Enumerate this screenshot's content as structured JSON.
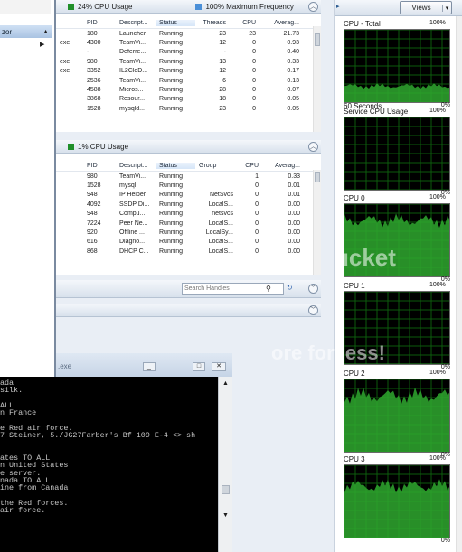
{
  "left_panel": {
    "menu_label": "zor"
  },
  "cpu_section": {
    "title": "24% CPU Usage",
    "freq": "100% Maximum Frequency",
    "color_cpu": "#1f8f2a",
    "color_freq": "#4a8fd8",
    "headers": [
      "PID",
      "Descript...",
      "Status",
      "Threads",
      "CPU",
      "Averag..."
    ],
    "partial_names": [
      "",
      "exe",
      "",
      "exe",
      "exe",
      "",
      "",
      "",
      ""
    ],
    "rows": [
      [
        "180",
        "Launcher",
        "Running",
        "23",
        "23",
        "21.73"
      ],
      [
        "4300",
        "TeamVi...",
        "Running",
        "12",
        "0",
        "0.93"
      ],
      [
        "-",
        "Deferre...",
        "Running",
        "-",
        "0",
        "0.40"
      ],
      [
        "980",
        "TeamVi...",
        "Running",
        "13",
        "0",
        "0.33"
      ],
      [
        "3352",
        "IL2CloD...",
        "Running",
        "12",
        "0",
        "0.17"
      ],
      [
        "2536",
        "TeamVi...",
        "Running",
        "6",
        "0",
        "0.13"
      ],
      [
        "4588",
        "Micros...",
        "Running",
        "28",
        "0",
        "0.07"
      ],
      [
        "3868",
        "Resour...",
        "Running",
        "18",
        "0",
        "0.05"
      ],
      [
        "1528",
        "mysqld...",
        "Running",
        "23",
        "0",
        "0.05"
      ]
    ]
  },
  "service_section": {
    "title": "1% CPU Usage",
    "color": "#1f8f2a",
    "headers": [
      "PID",
      "Descript...",
      "Status",
      "Group",
      "CPU",
      "Averag..."
    ],
    "rows": [
      [
        "980",
        "TeamVi...",
        "Running",
        "",
        "1",
        "0.33"
      ],
      [
        "1528",
        "mysql",
        "Running",
        "",
        "0",
        "0.01"
      ],
      [
        "948",
        "IP Helper",
        "Running",
        "NetSvcs",
        "0",
        "0.01"
      ],
      [
        "4092",
        "SSDP Di...",
        "Running",
        "LocalS...",
        "0",
        "0.00"
      ],
      [
        "948",
        "Compu...",
        "Running",
        "netsvcs",
        "0",
        "0.00"
      ],
      [
        "7224",
        "Peer Ne...",
        "Running",
        "LocalS...",
        "0",
        "0.00"
      ],
      [
        "920",
        "Offline ...",
        "Running",
        "LocalSy...",
        "0",
        "0.00"
      ],
      [
        "616",
        "Diagno...",
        "Running",
        "LocalS...",
        "0",
        "0.00"
      ],
      [
        "868",
        "DHCP C...",
        "Running",
        "LocalS...",
        "0",
        "0.00"
      ]
    ]
  },
  "handles": {
    "placeholder": "Search Handles"
  },
  "views_label": "Views",
  "graphs": [
    {
      "title": "CPU - Total",
      "top_pct": "100%",
      "bottom_pct": "0%",
      "caption": "60 Seconds"
    },
    {
      "title": "Service CPU Usage",
      "top_pct": "100%",
      "bottom_pct": "0%",
      "caption": ""
    },
    {
      "title": "CPU 0",
      "top_pct": "100%",
      "bottom_pct": "0%",
      "caption": ""
    },
    {
      "title": "CPU 1",
      "top_pct": "100%",
      "bottom_pct": "0%",
      "caption": ""
    },
    {
      "title": "CPU 2",
      "top_pct": "100%",
      "bottom_pct": "0%",
      "caption": ""
    },
    {
      "title": "CPU 3",
      "top_pct": "100%",
      "bottom_pct": "0%",
      "caption": ""
    }
  ],
  "cmd": {
    "title": ".exe",
    "lines": [
      "ada",
      "silk.",
      "",
      "ALL",
      "n France",
      "",
      "e Red air force.",
      "7 Steiner, 5./JG27Farber's Bf 109 E-4 <> sh",
      "",
      "",
      "ates TO ALL",
      "n United States",
      "e server.",
      "nada TO ALL",
      "ine from Canada",
      "",
      "the Red forces.",
      "air force."
    ]
  },
  "watermark": {
    "line1": "ucket",
    "line2": "ore for less!"
  }
}
